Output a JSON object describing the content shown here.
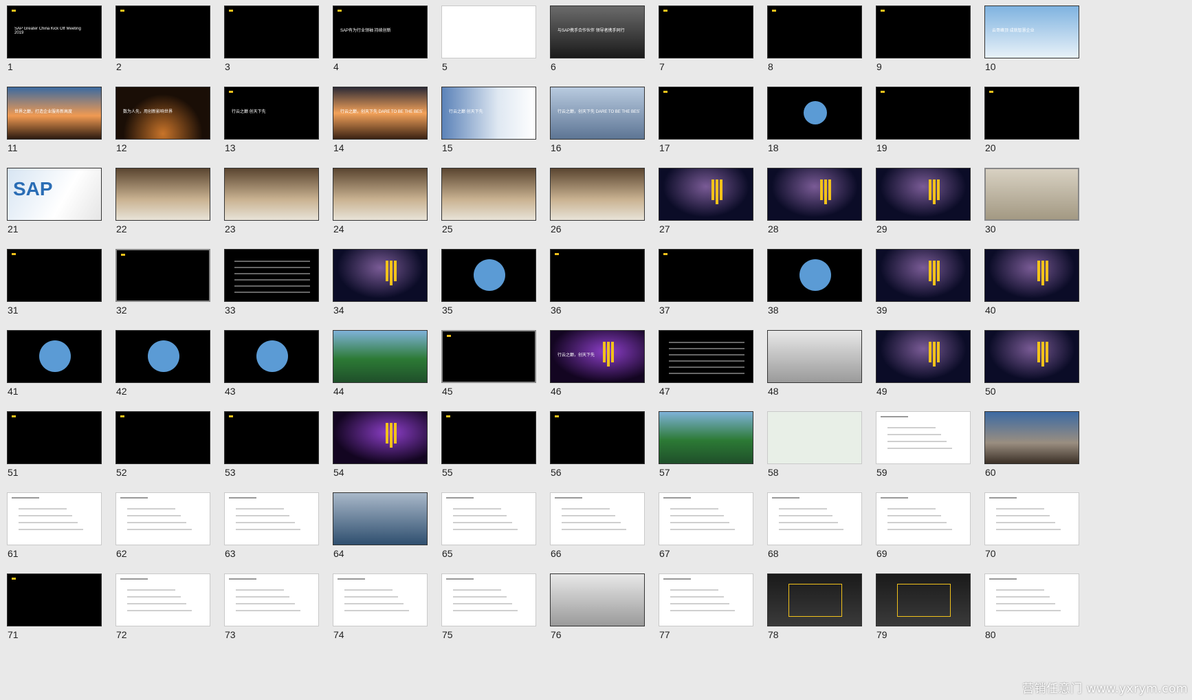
{
  "slides": [
    {
      "n": "1",
      "t": "SAP Greater China Kick Off Meeting\n2019",
      "s": "dark"
    },
    {
      "n": "2",
      "s": "dark"
    },
    {
      "n": "3",
      "s": "dark"
    },
    {
      "n": "4",
      "t": "SAP有为行业领袖 持续创新",
      "s": "dark"
    },
    {
      "n": "5",
      "s": "logos"
    },
    {
      "n": "6",
      "t": "与SAP携手合作伙伴 领导者携手同行",
      "s": "crowd"
    },
    {
      "n": "7",
      "s": "dark"
    },
    {
      "n": "8",
      "s": "dark"
    },
    {
      "n": "9",
      "s": "dark"
    },
    {
      "n": "10",
      "t": "云哥峰顶 成就智慧企业",
      "s": "sky"
    },
    {
      "n": "11",
      "t": "世界之巅，打造企业服务新高度",
      "s": "sunset"
    },
    {
      "n": "12",
      "t": "数为人先，用创新影响世界",
      "s": "earth"
    },
    {
      "n": "13",
      "t": "行云之巅 创天下先",
      "s": "dark"
    },
    {
      "n": "14",
      "t": "行云之巅，创天下先 DARE TO BE THE BEST",
      "s": "sunset2"
    },
    {
      "n": "15",
      "t": "行云之巅 创天下先",
      "s": "ink"
    },
    {
      "n": "16",
      "t": "行云之巅，创天下先 DARE TO BE THE BEST",
      "s": "sky2"
    },
    {
      "n": "17",
      "s": "dark"
    },
    {
      "n": "18",
      "s": "circle"
    },
    {
      "n": "19",
      "s": "dark"
    },
    {
      "n": "20",
      "s": "dark"
    },
    {
      "n": "21",
      "t": "SAP",
      "s": "sapwall"
    },
    {
      "n": "22",
      "s": "hall"
    },
    {
      "n": "23",
      "s": "hall"
    },
    {
      "n": "24",
      "s": "hall"
    },
    {
      "n": "25",
      "s": "hall"
    },
    {
      "n": "26",
      "s": "hall"
    },
    {
      "n": "27",
      "s": "stage"
    },
    {
      "n": "28",
      "s": "stage"
    },
    {
      "n": "29",
      "s": "stage"
    },
    {
      "n": "30",
      "s": "room"
    },
    {
      "n": "31",
      "s": "dark"
    },
    {
      "n": "32",
      "s": "dark"
    },
    {
      "n": "33",
      "s": "table"
    },
    {
      "n": "34",
      "s": "stage"
    },
    {
      "n": "35",
      "s": "circle"
    },
    {
      "n": "36",
      "s": "dark"
    },
    {
      "n": "37",
      "s": "dark"
    },
    {
      "n": "38",
      "s": "circle"
    },
    {
      "n": "39",
      "s": "stage"
    },
    {
      "n": "40",
      "s": "stage"
    },
    {
      "n": "41",
      "s": "circle"
    },
    {
      "n": "42",
      "s": "circle"
    },
    {
      "n": "43",
      "s": "circle"
    },
    {
      "n": "44",
      "s": "resort"
    },
    {
      "n": "45",
      "s": "dark"
    },
    {
      "n": "46",
      "t": "行云之巅，创天下先",
      "s": "purple"
    },
    {
      "n": "47",
      "s": "table"
    },
    {
      "n": "48",
      "s": "people"
    },
    {
      "n": "49",
      "s": "stage"
    },
    {
      "n": "50",
      "s": "stage"
    },
    {
      "n": "51",
      "s": "dark"
    },
    {
      "n": "52",
      "s": "dark"
    },
    {
      "n": "53",
      "s": "dark"
    },
    {
      "n": "54",
      "s": "purple"
    },
    {
      "n": "55",
      "s": "dark"
    },
    {
      "n": "56",
      "s": "dark"
    },
    {
      "n": "57",
      "s": "resort"
    },
    {
      "n": "58",
      "s": "map"
    },
    {
      "n": "59",
      "s": "light"
    },
    {
      "n": "60",
      "s": "building"
    },
    {
      "n": "61",
      "s": "light"
    },
    {
      "n": "62",
      "s": "light"
    },
    {
      "n": "63",
      "s": "light"
    },
    {
      "n": "64",
      "s": "tablet"
    },
    {
      "n": "65",
      "s": "light"
    },
    {
      "n": "66",
      "s": "light"
    },
    {
      "n": "67",
      "s": "light"
    },
    {
      "n": "68",
      "s": "light"
    },
    {
      "n": "69",
      "s": "light"
    },
    {
      "n": "70",
      "s": "light"
    },
    {
      "n": "71",
      "s": "dark"
    },
    {
      "n": "72",
      "s": "light"
    },
    {
      "n": "73",
      "s": "light"
    },
    {
      "n": "74",
      "s": "light"
    },
    {
      "n": "75",
      "s": "light"
    },
    {
      "n": "76",
      "s": "people"
    },
    {
      "n": "77",
      "s": "light"
    },
    {
      "n": "78",
      "s": "booth"
    },
    {
      "n": "79",
      "s": "booth"
    },
    {
      "n": "80",
      "s": "light"
    }
  ],
  "watermark": "营销任意门 www.yxrym.com",
  "colors": {
    "accent": "#f2c21b",
    "circle": "#5b9bd5",
    "background": "#e9e9e9"
  }
}
